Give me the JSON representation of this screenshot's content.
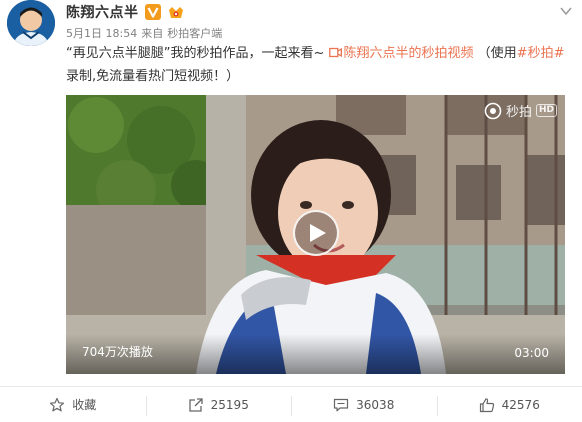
{
  "post": {
    "author": {
      "name": "陈翔六点半",
      "badge_icon": "verified-v-icon",
      "vip_icon": "vip-crown-icon"
    },
    "meta": {
      "time": "5月1日 18:54",
      "via": "来自",
      "source": "秒拍客户端"
    },
    "text": {
      "part1": "“再见六点半腿腿”我的秒拍作品，一起来看~ ",
      "video_link": "陈翔六点半的秒拍视频",
      "part2": "（使用",
      "topic": "#秒拍#",
      "part3": "录制,免流量看热门短视频！）"
    },
    "video": {
      "watermark": "秒拍",
      "hd": "HD",
      "play_count": "704万次播放",
      "duration": "03:00"
    },
    "actions": {
      "favorite": "收藏",
      "repost": "25195",
      "comment": "36038",
      "like": "42576"
    }
  }
}
